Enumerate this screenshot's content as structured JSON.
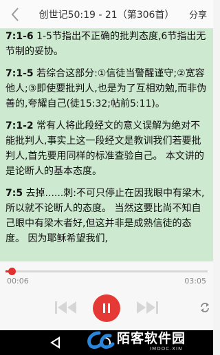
{
  "header": {
    "back_icon": "back-chevron-icon",
    "title": "创世记50:19 - 21（第306首）",
    "share_label": "分享"
  },
  "content": {
    "paragraphs": [
      {
        "ref": "7:1-6",
        "text": " 1-5节指出不正确的批判态度,6节指出无节制的妥协。"
      },
      {
        "ref": "7:1-5",
        "text": " 若综合这部分:①信徒当警醒谨守;②宽容他人;③即使要批判人,也是为了互相劝勉,而非伪善的,夸耀自己(徒15:32;帖前5:11)。"
      },
      {
        "ref": "7:1-2",
        "text": " 常有人将此段经文的意义误解为绝对不能批判人,事实上这一段经文是教训我们若要批判人,首先要用同样的标准查验自己。 本文讲的是论断人的基本态度。"
      },
      {
        "ref": "7:5",
        "text": " 去掉......刺:不可只停止在因我眼中有梁木,所以就不论断人的态度。 当然这要比尚不知自己眼中有梁木者好,但这并非是成熟信徒的态度。 因为耶稣希望我们,"
      }
    ]
  },
  "player": {
    "current_time": "00:06",
    "total_time": "03:05",
    "progress": 0.03,
    "accent_color": "#e53935",
    "prev_icon": "previous-track-icon",
    "play_icon": "pause-icon",
    "next_icon": "next-track-icon",
    "repeat_icon": "repeat-icon"
  },
  "watermark": {
    "text": "陌客软件园",
    "sub": "IMOOC.XIN"
  }
}
